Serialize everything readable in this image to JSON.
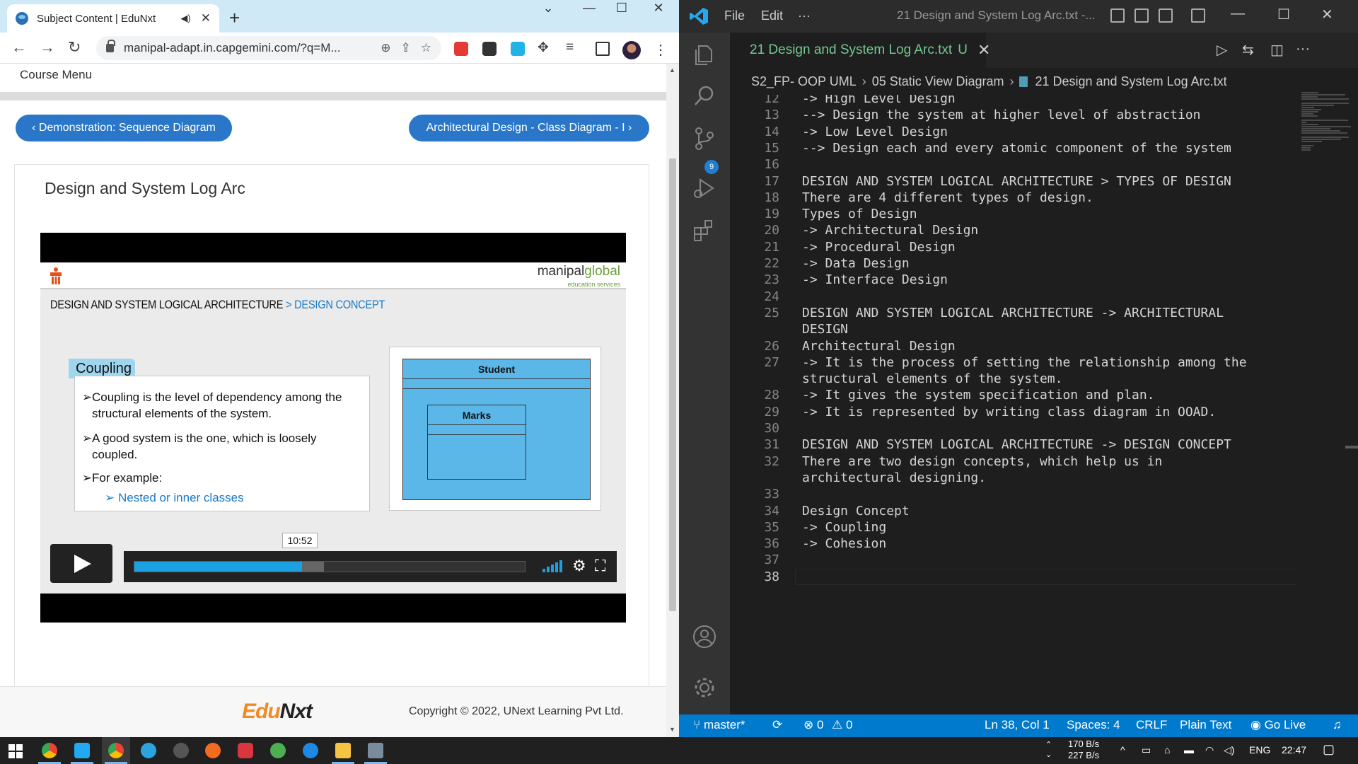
{
  "browser": {
    "tab_title": "Subject Content | EduNxt",
    "tab_audio_icon": "speaker-icon",
    "url": "manipal-adapt.in.capgemini.com/?q=M...",
    "new_tab": "+",
    "controls": {
      "minimize": "—",
      "maximize": "☐",
      "close": "✕",
      "tab_search": "⌄"
    }
  },
  "page": {
    "course_menu": "Course Menu",
    "prev_button": "‹ Demonstration: Sequence Diagram",
    "next_button": "Architectural Design - Class Diagram - I ›",
    "content_title": "Design and System Log Arc",
    "footer": {
      "logo_part1": "Edu",
      "logo_part2": "Nxt",
      "copyright": "Copyright © 2022, UNext Learning Pvt Ltd."
    }
  },
  "video": {
    "brand": "manipal",
    "brand_accent": "global",
    "brand_sub": "education services",
    "heading": "DESIGN AND SYSTEM LOGICAL ARCHITECTURE",
    "heading_sep": " > ",
    "heading_highlight": "DESIGN CONCEPT",
    "coupling_tag": "Coupling",
    "bullets": [
      "Coupling is the level of dependency among the structural elements of the system.",
      "A good system is the one, which is loosely coupled.",
      "For example:"
    ],
    "sub_bullet": "➢ Nested or inner classes",
    "bullet_marker": "➢",
    "uml_outer": "Student",
    "uml_inner": "Marks",
    "time_tooltip": "10:52",
    "progress": 0.43,
    "buffered": 0.485
  },
  "vscode": {
    "menu": [
      "File",
      "Edit",
      "···"
    ],
    "window_title": "21 Design and System Log Arc.txt -...",
    "tab_label": "21 Design and System Log Arc.txt",
    "tab_modified": "U",
    "breadcrumb": [
      "S2_FP- OOP UML",
      "05 Static View Diagram",
      "21 Design and System Log Arc.txt"
    ],
    "scm_badge": "9",
    "lines": [
      {
        "n": "12",
        "t": "-> High Level Design"
      },
      {
        "n": "13",
        "t": "--> Design the system at higher level of abstraction"
      },
      {
        "n": "14",
        "t": "-> Low Level Design"
      },
      {
        "n": "15",
        "t": "--> Design each and every atomic component of the system"
      },
      {
        "n": "16",
        "t": ""
      },
      {
        "n": "17",
        "t": "DESIGN AND SYSTEM LOGICAL ARCHITECTURE > TYPES OF DESIGN"
      },
      {
        "n": "18",
        "t": "There are 4 different types of design."
      },
      {
        "n": "19",
        "t": "Types of Design"
      },
      {
        "n": "20",
        "t": "-> Architectural Design"
      },
      {
        "n": "21",
        "t": "-> Procedural Design"
      },
      {
        "n": "22",
        "t": "-> Data Design"
      },
      {
        "n": "23",
        "t": "-> Interface Design"
      },
      {
        "n": "24",
        "t": ""
      },
      {
        "n": "25",
        "t": "DESIGN AND SYSTEM LOGICAL ARCHITECTURE -> ARCHITECTURAL"
      },
      {
        "n": "",
        "t": "DESIGN"
      },
      {
        "n": "26",
        "t": "Architectural Design"
      },
      {
        "n": "27",
        "t": "-> It is the process of setting the relationship among the"
      },
      {
        "n": "",
        "t": "structural elements of the system."
      },
      {
        "n": "28",
        "t": "-> It gives the system specification and plan."
      },
      {
        "n": "29",
        "t": "-> It is represented by writing class diagram in OOAD."
      },
      {
        "n": "30",
        "t": ""
      },
      {
        "n": "31",
        "t": "DESIGN AND SYSTEM LOGICAL ARCHITECTURE -> DESIGN CONCEPT"
      },
      {
        "n": "32",
        "t": "There are two design concepts, which help us in"
      },
      {
        "n": "",
        "t": "architectural designing."
      },
      {
        "n": "33",
        "t": ""
      },
      {
        "n": "34",
        "t": "Design Concept"
      },
      {
        "n": "35",
        "t": "-> Coupling"
      },
      {
        "n": "36",
        "t": "-> Cohesion"
      },
      {
        "n": "37",
        "t": ""
      },
      {
        "n": "38",
        "t": ""
      }
    ],
    "status": {
      "branch": "master*",
      "sync": "⟳",
      "errors": "⊗ 0",
      "warnings": "⚠ 0",
      "position": "Ln 38, Col 1",
      "spaces": "Spaces: 4",
      "eol": "CRLF",
      "language": "Plain Text",
      "golive": "Go Live"
    }
  },
  "taskbar": {
    "net_up": "170 B/s",
    "net_down": "227 B/s",
    "lang": "ENG",
    "time": "22:47"
  },
  "colors": {
    "accent_blue": "#2a77c9",
    "vscode_status": "#007acc",
    "progress": "#1ba1e2",
    "edunxt_orange": "#f08a24"
  }
}
